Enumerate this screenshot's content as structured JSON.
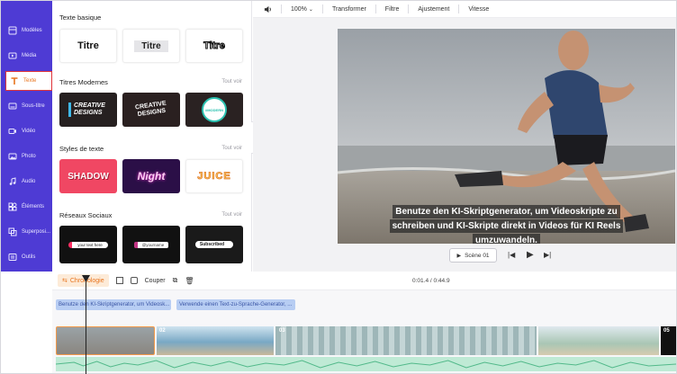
{
  "sidebar": {
    "items": [
      {
        "label": "Modèles",
        "icon": "templates-icon"
      },
      {
        "label": "Média",
        "icon": "media-icon"
      },
      {
        "label": "Texte",
        "icon": "text-icon",
        "active": true
      },
      {
        "label": "Sous-titre",
        "icon": "subtitle-icon"
      },
      {
        "label": "Vidéo",
        "icon": "video-icon"
      },
      {
        "label": "Photo",
        "icon": "photo-icon"
      },
      {
        "label": "Audio",
        "icon": "audio-icon"
      },
      {
        "label": "Éléments",
        "icon": "elements-icon"
      },
      {
        "label": "Superposi...",
        "icon": "overlay-icon"
      },
      {
        "label": "Outils",
        "icon": "tools-icon"
      }
    ]
  },
  "panel": {
    "basic": {
      "title": "Texte basique",
      "cards": [
        "Titre",
        "Titre",
        "Titre"
      ]
    },
    "modern": {
      "title": "Titres Modernes",
      "see_all": "Tout voir",
      "cards": [
        "CREATIVE DESIGNS",
        "CREATIVE DESIGNS",
        "#MODERN"
      ]
    },
    "styles": {
      "title": "Styles de texte",
      "see_all": "Tout voir",
      "cards": [
        "SHADOW",
        "Night",
        "JUICE"
      ]
    },
    "social": {
      "title": "Réseaux Sociaux",
      "see_all": "Tout voir",
      "cards": [
        "your text here",
        "@yourname",
        "Subscribed"
      ]
    }
  },
  "toolbar": {
    "zoom": "100%",
    "transform": "Transformer",
    "filter": "Filtre",
    "adjust": "Ajustement",
    "speed": "Vitesse"
  },
  "player": {
    "caption_lines": [
      "Benutze den KI-Skriptgenerator, um Videoskripte zu",
      "schreiben und KI-Skripte direkt in Videos für KI Reels",
      "umzuwandeln."
    ],
    "scene_label": "Scène 01"
  },
  "timeline": {
    "tab": "Chronologie",
    "cut": "Couper",
    "time": "0:01.4 / 0:44.9",
    "text_clips": [
      "Benutze den KI-Skriptgenerator, um Videosk...",
      "Verwende einen Text-zu-Sprache-Generator, ..."
    ],
    "clip_numbers": [
      "02",
      "03",
      "05"
    ]
  },
  "colors": {
    "sidebar": "#4e3bd4",
    "accent": "#e8741e",
    "active_border": "#e0343a"
  }
}
